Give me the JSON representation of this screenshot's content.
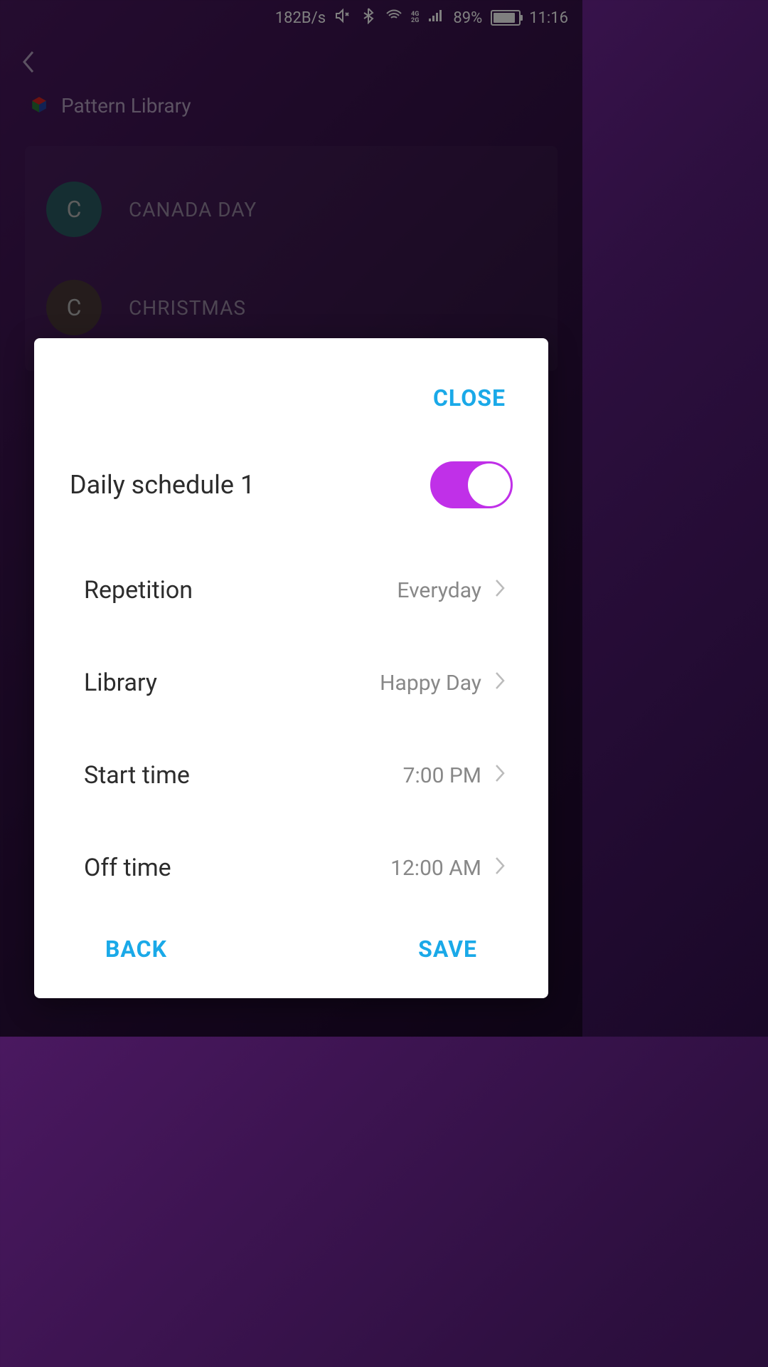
{
  "status_bar": {
    "net_speed": "182B/s",
    "battery_percent": "89%",
    "time": "11:16",
    "signal_labels": {
      "top": "4G",
      "bottom": "2G"
    }
  },
  "page": {
    "title": "Pattern Library"
  },
  "patterns": [
    {
      "initial": "C",
      "name": "CANADA DAY",
      "avatar_class": "avatar-teal"
    },
    {
      "initial": "C",
      "name": "CHRISTMAS",
      "avatar_class": "avatar-brown"
    }
  ],
  "dialog": {
    "close_label": "CLOSE",
    "title": "Daily schedule 1",
    "toggle_on": true,
    "settings": [
      {
        "label": "Repetition",
        "value": "Everyday"
      },
      {
        "label": "Library",
        "value": "Happy Day"
      },
      {
        "label": "Start time",
        "value": "7:00 PM"
      },
      {
        "label": "Off time",
        "value": "12:00 AM"
      }
    ],
    "back_label": "BACK",
    "save_label": "SAVE"
  }
}
